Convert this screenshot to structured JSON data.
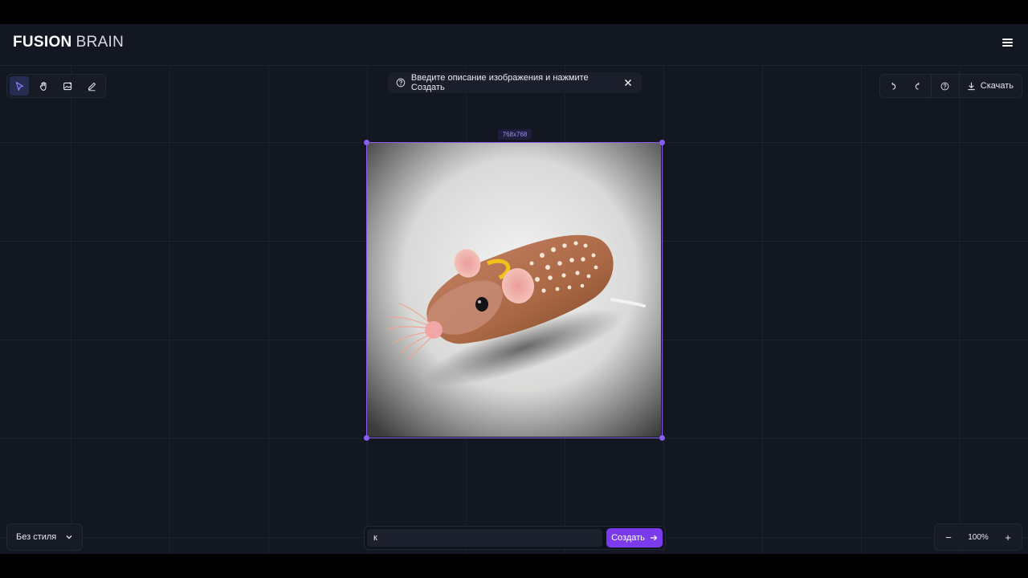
{
  "logo": {
    "bold": "FUSION",
    "light": "BRAIN"
  },
  "hint": {
    "text": "Введите описание изображения и нажмите Создать"
  },
  "canvas": {
    "dimensions": "768x768"
  },
  "toolbar_right": {
    "download_label": "Скачать"
  },
  "style_select": {
    "value": "Без стиля"
  },
  "prompt": {
    "value": "к",
    "create_label": "Создать"
  },
  "zoom": {
    "minus": "−",
    "value": "100%",
    "plus": "+"
  },
  "icons": {
    "tools_left": [
      "cursor-icon",
      "hand-icon",
      "image-icon",
      "pencil-icon"
    ],
    "tools_right": [
      "undo-icon",
      "redo-icon",
      "help-icon",
      "download-icon"
    ]
  },
  "colors": {
    "accent": "#8b5cf6",
    "button": "#7c3aed",
    "background": "#131722"
  }
}
